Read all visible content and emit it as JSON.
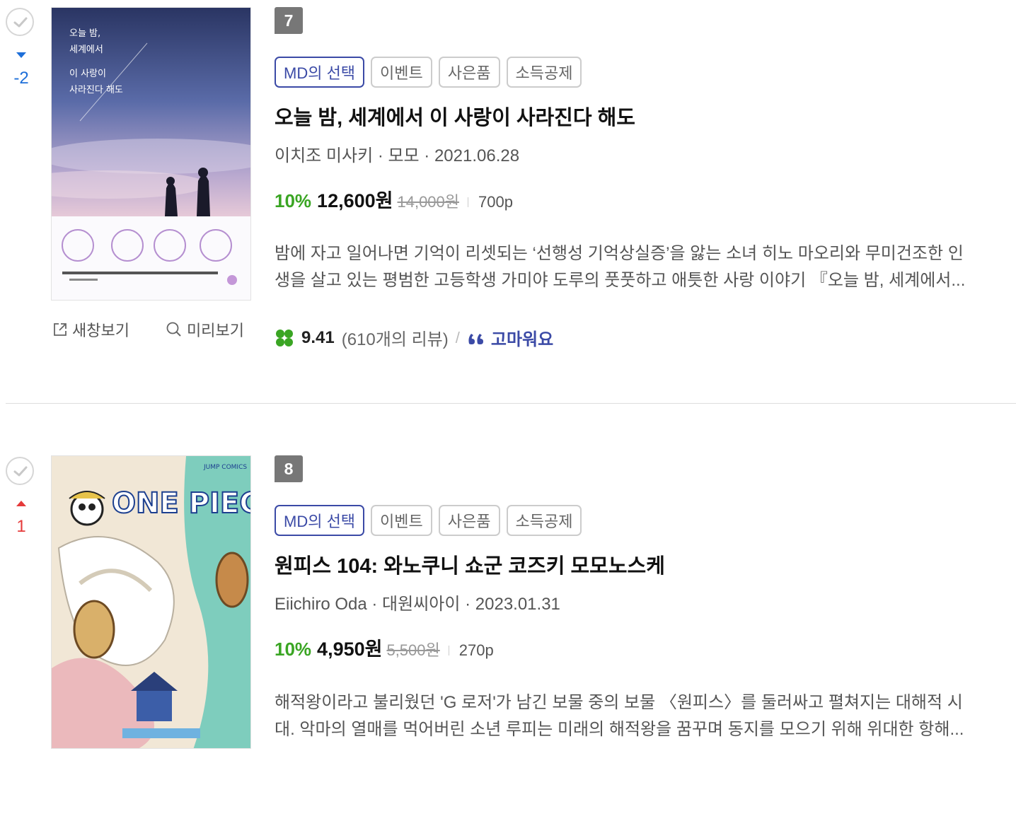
{
  "actions": {
    "new_window": "새창보기",
    "preview": "미리보기"
  },
  "books": [
    {
      "rank": "7",
      "rank_change": "-2",
      "tags": [
        "MD의 선택",
        "이벤트",
        "사은품",
        "소득공제"
      ],
      "title": "오늘 밤, 세계에서 이 사랑이 사라진다 해도",
      "meta": "이치조 미사키 · 모모 · 2021.06.28",
      "discount": "10%",
      "sale_price": "12,600원",
      "orig_price": "14,000원",
      "pages": "700p",
      "desc_line1": "밤에 자고 일어나면 기억이 리셋되는 ‘선행성 기억상실증’을 앓는 소녀 히노 마오리와 무미건조한 인",
      "desc_line2": "생을 살고 있는 평범한 고등학생 가미야 도루의 풋풋하고 애틋한 사랑 이야기 『오늘 밤, 세계에서...",
      "rating": "9.41",
      "reviews": "(610개의 리뷰)",
      "thanks": "고마워요",
      "cover_text": "오늘 밤, 세계에서 이 사랑이 사라진다 해도"
    },
    {
      "rank": "8",
      "rank_change": "1",
      "tags": [
        "MD의 선택",
        "이벤트",
        "사은품",
        "소득공제"
      ],
      "title": "원피스 104: 와노쿠니 쇼군 코즈키 모모노스케",
      "meta": "Eiichiro Oda · 대원씨아이 · 2023.01.31",
      "discount": "10%",
      "sale_price": "4,950원",
      "orig_price": "5,500원",
      "pages": "270p",
      "desc_line1": "해적왕이라고 불리웠던 'G 로저'가 남긴 보물 중의 보물 〈원피스〉를 둘러싸고 펼쳐지는 대해적 시",
      "desc_line2": "대. 악마의 열매를 먹어버린 소년 루피는 미래의 해적왕을 꿈꾸며 동지를 모으기 위해 위대한 항해...",
      "cover_text": "ONE PIECE"
    }
  ],
  "colors": {
    "discount": "#3aa523",
    "md_tag": "#3b4aa6",
    "rank_down": "#1e6fd9",
    "rank_up": "#e53a3a",
    "badge": "#777777"
  },
  "icons": [
    "check-icon",
    "rank-down-icon",
    "rank-up-icon",
    "external-link-icon",
    "search-icon",
    "clover-icon",
    "quote-icon"
  ]
}
